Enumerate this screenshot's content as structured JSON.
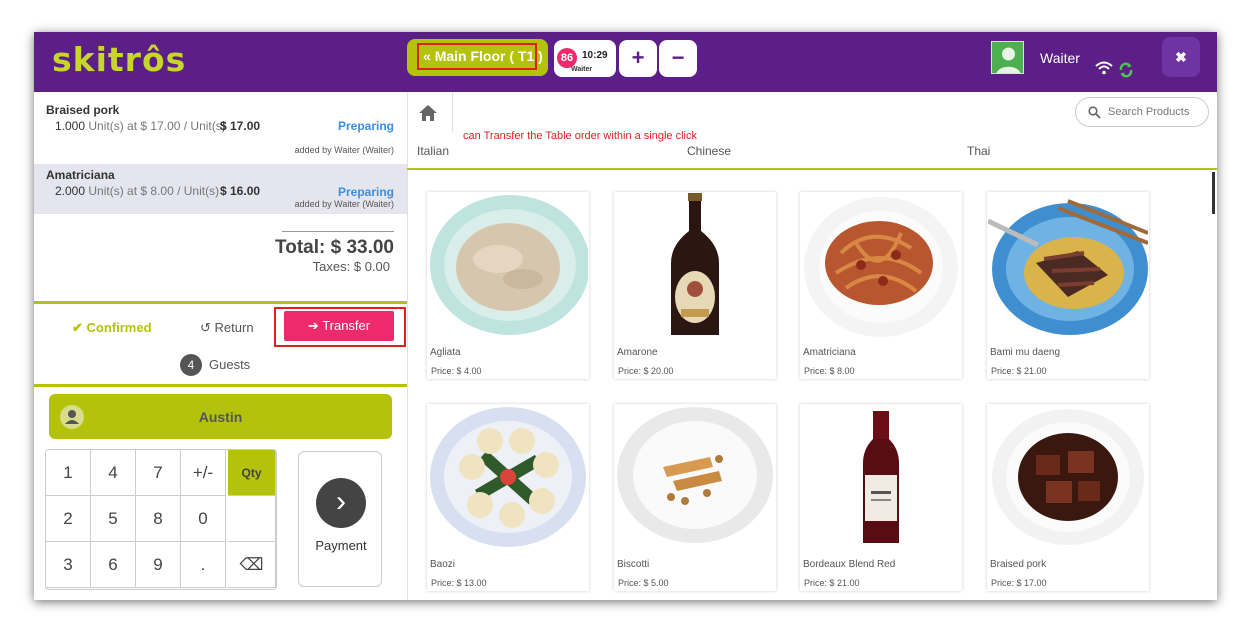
{
  "brand": {
    "logo": "skitrôs"
  },
  "header": {
    "floor_label": "Main Floor ( T1 )",
    "table_number": "86",
    "table_time": "10:29",
    "table_user": "Waiter",
    "plus_label": "+",
    "minus_label": "−",
    "user_name": "Waiter",
    "close_label": "✖"
  },
  "order": {
    "lines": [
      {
        "name": "Braised pork",
        "qty": "1.000",
        "unit_text": "Unit(s) at $ 17.00 / Unit(s)",
        "price": "$ 17.00",
        "status": "Preparing",
        "added_by": "added by Waiter (Waiter)"
      },
      {
        "name": "Amatriciana",
        "qty": "2.000",
        "unit_text": "Unit(s) at $ 8.00 / Unit(s)",
        "price": "$ 16.00",
        "status": "Preparing",
        "added_by": "added by Waiter (Waiter)"
      }
    ],
    "total": "Total: $ 33.00",
    "taxes": "Taxes: $ 0.00"
  },
  "actions": {
    "confirmed": "Confirmed",
    "return": "Return",
    "transfer": "Transfer",
    "guest_count": "4",
    "guests_label": "Guests",
    "customer_name": "Austin"
  },
  "numpad": {
    "keys": [
      "1",
      "4",
      "7",
      "+/-",
      "Qty",
      "2",
      "5",
      "8",
      "0",
      "",
      "3",
      "6",
      "9",
      ".",
      "⌫"
    ],
    "payment_label": "Payment",
    "accent": "#b5c20c"
  },
  "products_panel": {
    "hint": "can Transfer the Table order within a single click",
    "search_placeholder": "Search Products",
    "categories": [
      "Italian",
      "Chinese",
      "Thai"
    ]
  },
  "products": [
    {
      "name": "Agliata",
      "price": "Price: $ 4.00",
      "icon": "cream-sauce-bowl"
    },
    {
      "name": "Amarone",
      "price": "Price: $ 20.00",
      "icon": "wine-bottle"
    },
    {
      "name": "Amatriciana",
      "price": "Price: $ 8.00",
      "icon": "pasta-plate"
    },
    {
      "name": "Bami mu daeng",
      "price": "Price: $ 21.00",
      "icon": "noodle-bowl"
    },
    {
      "name": "Baozi",
      "price": "Price: $ 13.00",
      "icon": "dumpling-plate"
    },
    {
      "name": "Biscotti",
      "price": "Price: $ 5.00",
      "icon": "biscotti-plate"
    },
    {
      "name": "Bordeaux Blend Red",
      "price": "Price: $ 21.00",
      "icon": "red-wine-bottle"
    },
    {
      "name": "Braised pork",
      "price": "Price: $ 17.00",
      "icon": "braised-pork-plate"
    }
  ],
  "colors": {
    "purple": "#5b1f87",
    "olive": "#b5c20c",
    "pink": "#ec2a6c",
    "blue": "#3a8fe0"
  }
}
